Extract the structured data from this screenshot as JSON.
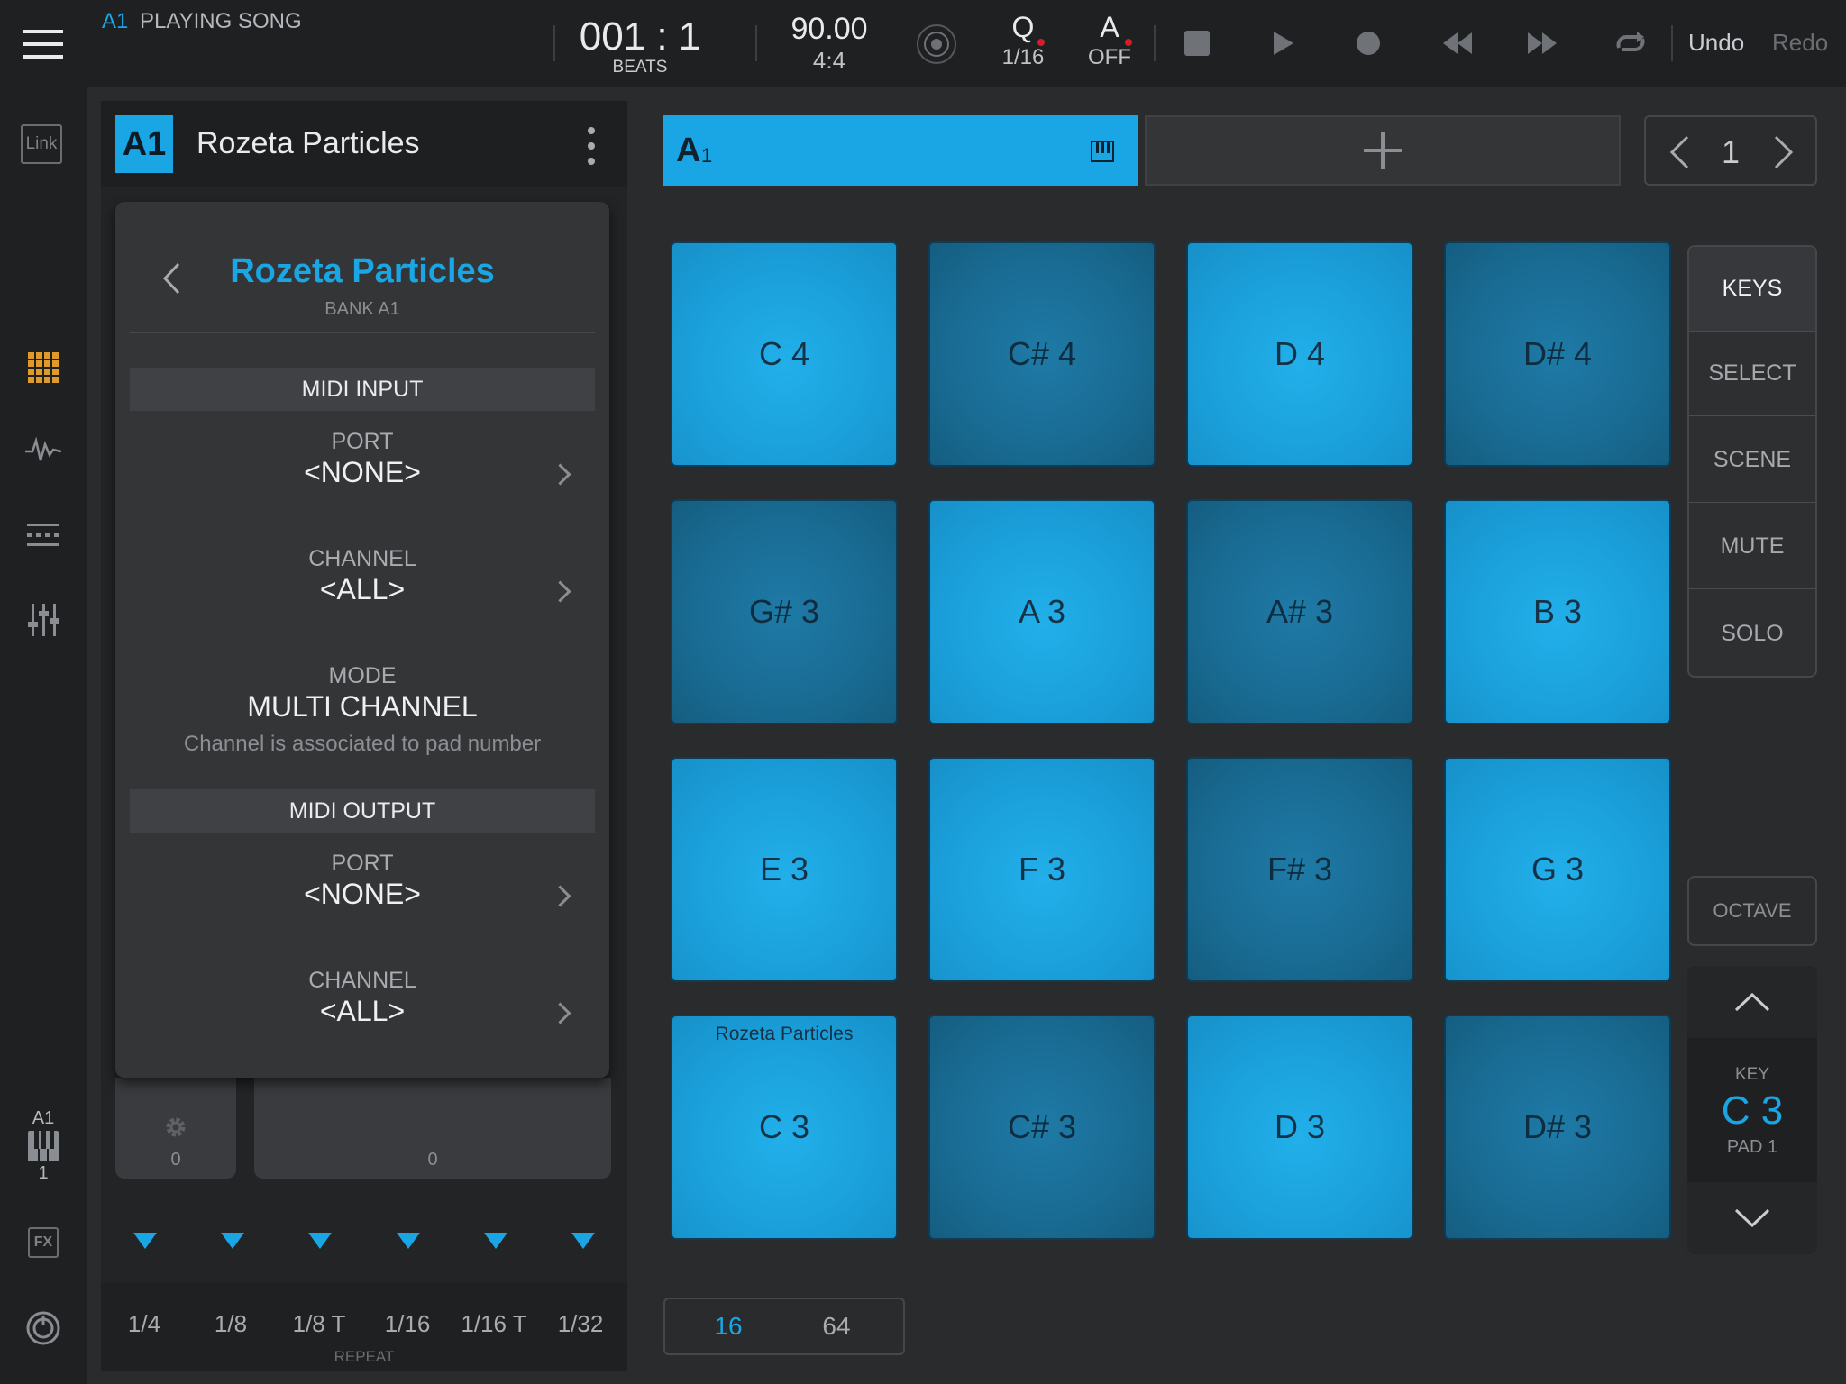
{
  "topbar": {
    "track_tag": "A1",
    "status": "PLAYING SONG",
    "position": "001 : 1",
    "position_unit": "BEATS",
    "tempo": "90.00",
    "signature": "4:4",
    "quantize_label": "Q",
    "quantize_value": "1/16",
    "auto_label": "A",
    "auto_value": "OFF",
    "undo": "Undo",
    "redo": "Redo"
  },
  "leftbar": {
    "link_label": "Link",
    "track_label": "A1",
    "track_number": "1",
    "fx_label": "FX"
  },
  "panel": {
    "badge": "A1",
    "title": "Rozeta Particles",
    "knob_value": "0",
    "slider_value": "0",
    "repeat_options": [
      "1/4",
      "1/8",
      "1/8 T",
      "1/16",
      "1/16 T",
      "1/32"
    ],
    "repeat_label": "REPEAT"
  },
  "popup": {
    "title": "Rozeta Particles",
    "subtitle": "BANK A1",
    "midi_input": {
      "header": "MIDI INPUT",
      "port_label": "PORT",
      "port_value": "<NONE>",
      "channel_label": "CHANNEL",
      "channel_value": "<ALL>",
      "mode_label": "MODE",
      "mode_value": "MULTI CHANNEL",
      "mode_desc": "Channel is associated to pad number"
    },
    "midi_output": {
      "header": "MIDI OUTPUT",
      "port_label": "PORT",
      "port_value": "<NONE>",
      "channel_label": "CHANNEL",
      "channel_value": "<ALL>"
    }
  },
  "pads_header": {
    "tab_label": "A",
    "tab_sub": "1",
    "page_number": "1"
  },
  "pads": [
    {
      "note": "C 4",
      "shade": "light"
    },
    {
      "note": "C# 4",
      "shade": "dark"
    },
    {
      "note": "D 4",
      "shade": "light"
    },
    {
      "note": "D# 4",
      "shade": "dark"
    },
    {
      "note": "G# 3",
      "shade": "dark"
    },
    {
      "note": "A 3",
      "shade": "light"
    },
    {
      "note": "A# 3",
      "shade": "dark"
    },
    {
      "note": "B 3",
      "shade": "light"
    },
    {
      "note": "E 3",
      "shade": "light"
    },
    {
      "note": "F 3",
      "shade": "light"
    },
    {
      "note": "F# 3",
      "shade": "dark"
    },
    {
      "note": "G 3",
      "shade": "light"
    },
    {
      "note": "C 3",
      "shade": "light",
      "label": "Rozeta Particles"
    },
    {
      "note": "C# 3",
      "shade": "dark"
    },
    {
      "note": "D 3",
      "shade": "light"
    },
    {
      "note": "D# 3",
      "shade": "dark"
    }
  ],
  "modes": [
    "KEYS",
    "SELECT",
    "SCENE",
    "MUTE",
    "SOLO"
  ],
  "octave": {
    "label": "OCTAVE",
    "key_label": "KEY",
    "key_value": "C 3",
    "pad_label": "PAD 1"
  },
  "pad_count": {
    "options": [
      "16",
      "64"
    ],
    "selected": "16"
  },
  "colors": {
    "accent": "#1aa6e4",
    "record_dot": "#d21f2a"
  }
}
